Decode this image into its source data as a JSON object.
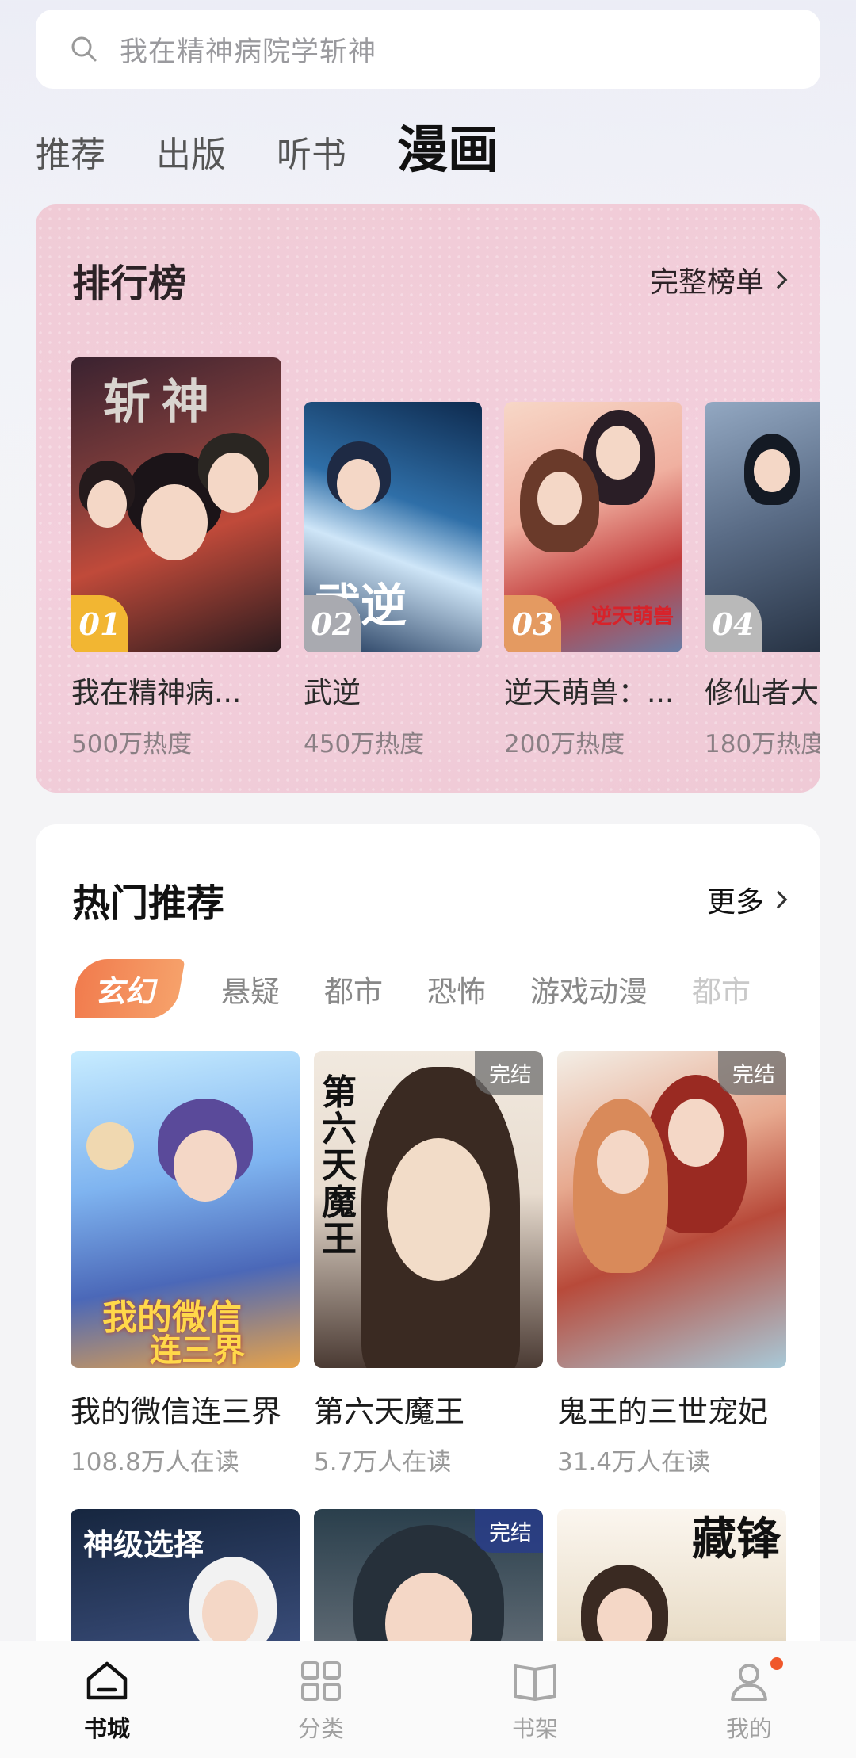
{
  "search": {
    "placeholder": "我在精神病院学斩神"
  },
  "tabs": [
    {
      "label": "推荐",
      "active": false
    },
    {
      "label": "出版",
      "active": false
    },
    {
      "label": "听书",
      "active": false
    },
    {
      "label": "漫画",
      "active": true
    }
  ],
  "ranking": {
    "title": "排行榜",
    "more": "完整榜单",
    "items": [
      {
        "rank": "01",
        "name": "我在精神病...",
        "heat": "500万热度",
        "rank_color": "#f2b632"
      },
      {
        "rank": "02",
        "name": "武逆",
        "heat": "450万热度",
        "rank_color": "#a9aab0"
      },
      {
        "rank": "03",
        "name": "逆天萌兽：...",
        "heat": "200万热度",
        "rank_color": "#e49a61"
      },
      {
        "rank": "04",
        "name": "修仙者大",
        "heat": "180万热度",
        "rank_color": "#b9b9b9"
      }
    ]
  },
  "hot": {
    "title": "热门推荐",
    "more": "更多",
    "genres": [
      "玄幻",
      "悬疑",
      "都市",
      "恐怖",
      "游戏动漫",
      "都市"
    ],
    "active_genre": "玄幻",
    "books": [
      {
        "title": "我的微信连三界",
        "reads": "108.8万人在读",
        "badge": ""
      },
      {
        "title": "第六天魔王",
        "reads": "5.7万人在读",
        "badge": "完结"
      },
      {
        "title": "鬼王的三世宠妃",
        "reads": "31.4万人在读",
        "badge": "完结"
      },
      {
        "title": "",
        "reads": "",
        "badge": ""
      },
      {
        "title": "",
        "reads": "",
        "badge": "完结"
      },
      {
        "title": "",
        "reads": "",
        "badge": ""
      }
    ]
  },
  "nav": [
    {
      "label": "书城",
      "icon": "home-icon",
      "active": true
    },
    {
      "label": "分类",
      "icon": "grid-icon",
      "active": false
    },
    {
      "label": "书架",
      "icon": "book-icon",
      "active": false
    },
    {
      "label": "我的",
      "icon": "user-icon",
      "active": false,
      "dot": true
    }
  ],
  "colors": {
    "accent": "#f17c4e",
    "rank_bg": "#f1cbd7",
    "notify": "#f0572a"
  }
}
